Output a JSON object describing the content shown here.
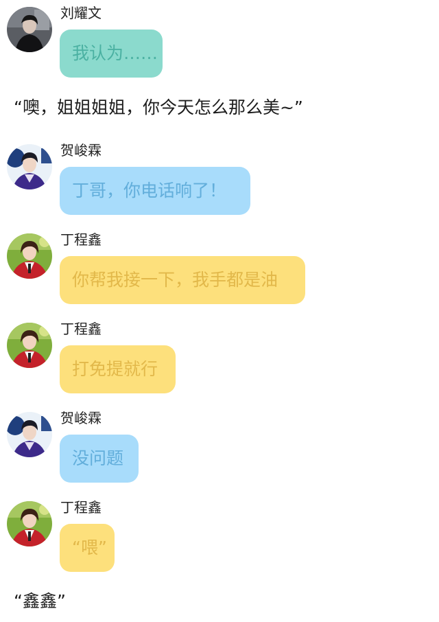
{
  "messages": [
    {
      "kind": "chat",
      "sender": "刘耀文",
      "text": "我认为……",
      "bubble_color": "#8bdacd",
      "avatar": "liu-yaowen-avatar"
    },
    {
      "kind": "narration",
      "text": "“噢，姐姐姐姐，你今天怎么那么美~”"
    },
    {
      "kind": "chat",
      "sender": "贺峻霖",
      "text": "丁哥，你电话响了！",
      "bubble_color": "#a8dcfb",
      "avatar": "he-junlin-avatar"
    },
    {
      "kind": "chat",
      "sender": "丁程鑫",
      "text": "你帮我接一下，我手都是油",
      "bubble_color": "#fde07c",
      "avatar": "ding-chengxin-avatar"
    },
    {
      "kind": "chat",
      "sender": "丁程鑫",
      "text": "打免提就行",
      "bubble_color": "#fde07c",
      "avatar": "ding-chengxin-avatar"
    },
    {
      "kind": "chat",
      "sender": "贺峻霖",
      "text": "没问题",
      "bubble_color": "#a8dcfb",
      "avatar": "he-junlin-avatar"
    },
    {
      "kind": "chat",
      "sender": "丁程鑫",
      "text": "“喂”",
      "bubble_color": "#fde07c",
      "avatar": "ding-chengxin-avatar"
    },
    {
      "kind": "narration",
      "text": "“鑫鑫”"
    }
  ]
}
